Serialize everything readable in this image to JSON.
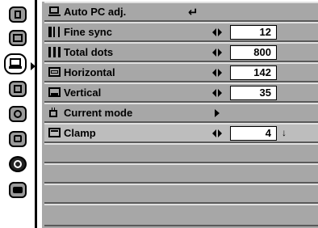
{
  "sidebar": {
    "icons": [
      {
        "name": "input-icon"
      },
      {
        "name": "image-select-icon"
      },
      {
        "name": "pc-adjust-icon",
        "active": true
      },
      {
        "name": "screen-icon"
      },
      {
        "name": "color-adjust-icon"
      },
      {
        "name": "setting-icon"
      },
      {
        "name": "sound-icon"
      },
      {
        "name": "keystone-icon"
      }
    ]
  },
  "menu": {
    "rows": [
      {
        "label": "Auto PC adj.",
        "icon": "pc-monitor-icon",
        "control": "enter",
        "value": ""
      },
      {
        "label": "Fine sync",
        "icon": "fine-sync-icon",
        "control": "slider",
        "value": "12"
      },
      {
        "label": "Total dots",
        "icon": "total-dots-icon",
        "control": "slider",
        "value": "800"
      },
      {
        "label": "Horizontal",
        "icon": "horizontal-icon",
        "control": "slider",
        "value": "142"
      },
      {
        "label": "Vertical",
        "icon": "vertical-icon",
        "control": "slider",
        "value": "35"
      },
      {
        "label": "Current mode",
        "icon": "current-mode-icon",
        "control": "submenu",
        "value": ""
      },
      {
        "label": "Clamp",
        "icon": "clamp-icon",
        "control": "slider",
        "value": "4"
      }
    ]
  }
}
